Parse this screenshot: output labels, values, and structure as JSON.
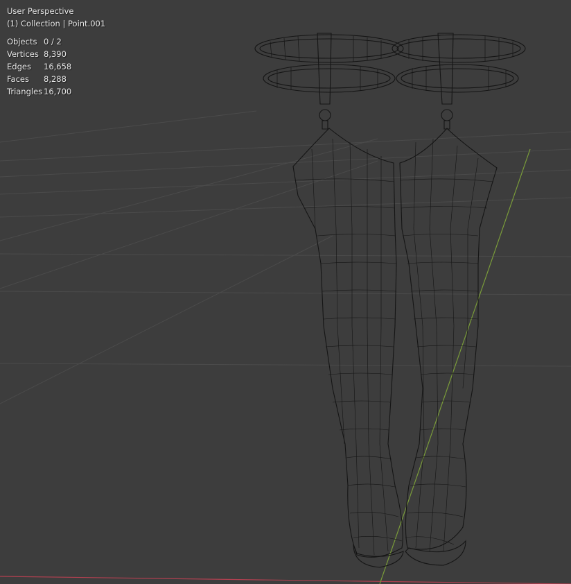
{
  "viewport": {
    "view_name": "User Perspective",
    "collection_info": "(1) Collection | Point.001",
    "stats": [
      {
        "label": "Objects",
        "value": "0 / 2"
      },
      {
        "label": "Vertices",
        "value": "8,390"
      },
      {
        "label": "Edges",
        "value": "16,658"
      },
      {
        "label": "Faces",
        "value": "8,288"
      },
      {
        "label": "Triangles",
        "value": "16,700"
      }
    ]
  },
  "colors": {
    "background": "#3d3d3d",
    "grid": "#4a4a4a",
    "x_axis": "#b04050",
    "y_axis": "#7a9c3a",
    "wireframe": "#151515",
    "overlay_text": "#e6e6e6"
  }
}
